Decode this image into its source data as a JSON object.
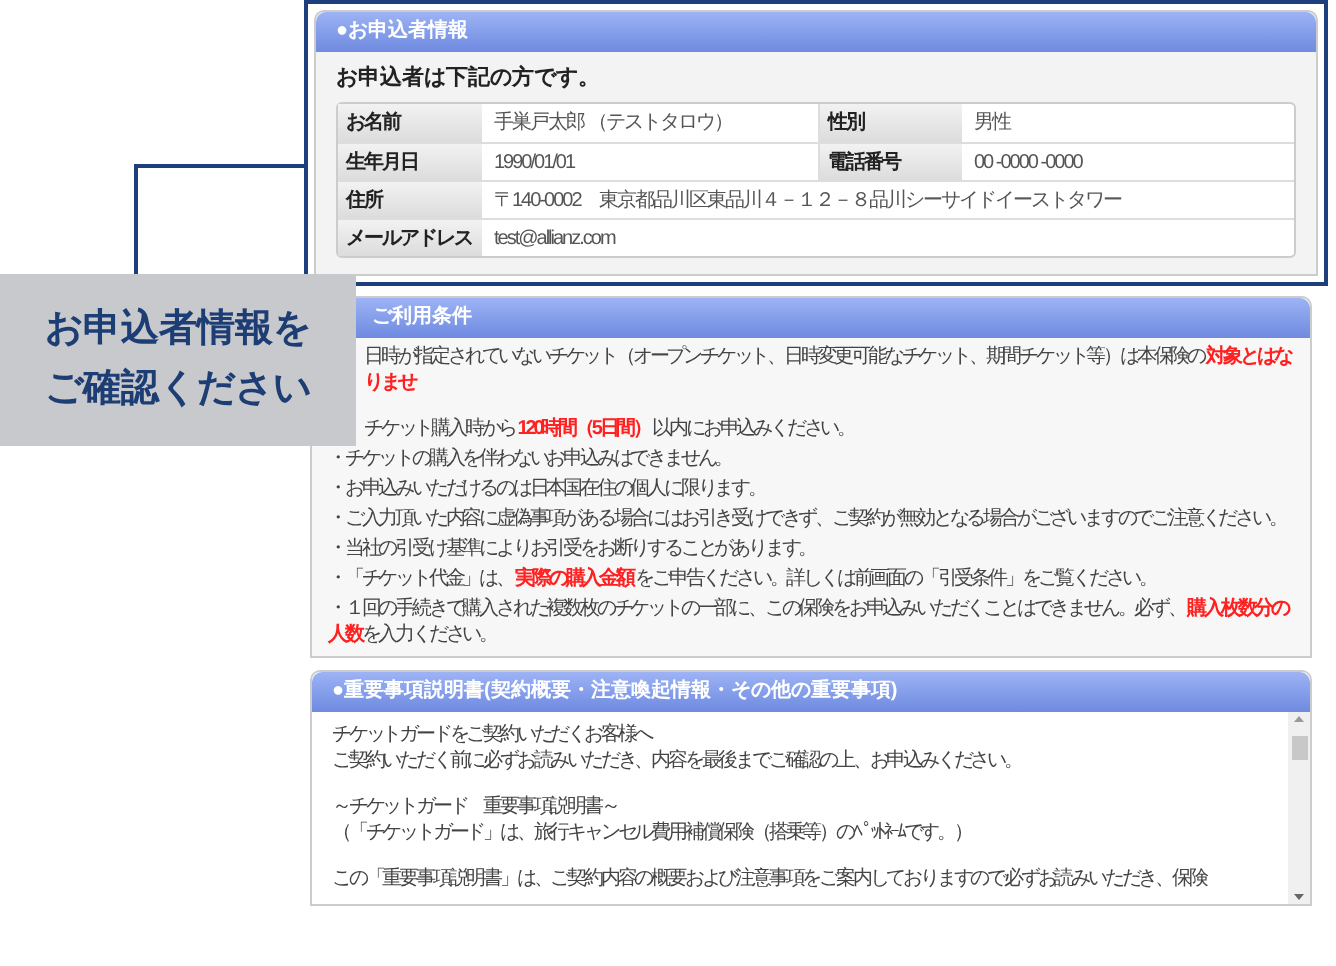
{
  "applicant": {
    "title": "●お申込者情報",
    "heading": "お申込者は下記の方です。",
    "rows": [
      [
        {
          "label": "お名前",
          "value": "手巣戸太郎 （テストタロウ）"
        },
        {
          "label": "性別",
          "value": "男性"
        }
      ],
      [
        {
          "label": "生年月日",
          "value": "1990/01/01"
        },
        {
          "label": "電話番号",
          "value": "00 -0000 -0000"
        }
      ],
      [
        {
          "label": "住所",
          "value": "〒140-0002　東京都品川区東品川４－１２－８品川シーサイドイーストタワー"
        }
      ],
      [
        {
          "label": "メールアドレス",
          "value": "test@allianz.com"
        }
      ]
    ]
  },
  "callout": {
    "lines": [
      "お申込者情報を",
      "ご確認ください"
    ]
  },
  "conditions": {
    "title": "ご利用条件",
    "items": [
      [
        {
          "text": "日時が指定されていないチケット（オープンチケット、日時変更可能なチケット、期間チケット等）は本保険の "
        },
        {
          "text": "対象とはなりませ",
          "emphasis": true
        }
      ],
      [
        {
          "text": "チケット購入時から "
        },
        {
          "text": "120時間（5日間）",
          "emphasis": true
        },
        {
          "text": " 以内にお申込みください。"
        }
      ],
      [
        {
          "text": "・チケットの購入を伴わないお申込みはできません。"
        }
      ],
      [
        {
          "text": "・お申込みいただけるのは日本国在住の個人に限ります。"
        }
      ],
      [
        {
          "text": "・ご入力頂いた内容に虚偽事項がある場合にはお引き受けできず、ご契約が無効となる場合がございますのでご注意ください。"
        }
      ],
      [
        {
          "text": "・当社の引受け基準によりお引受をお断りすることがあります。"
        }
      ],
      [
        {
          "text": "・「チケット代金」は、 "
        },
        {
          "text": "実際の購入金額",
          "emphasis": true
        },
        {
          "text": " をご申告ください。詳しくは前画面の「引受条件」をご覧ください。"
        }
      ],
      [
        {
          "text": "・１回の手続きで購入された複数枚のチケットの一部に、この保険をお申込みいただくことはできません。必ず、 "
        },
        {
          "text": "購入枚数分の人数",
          "emphasis": true
        },
        {
          "text": "を入力ください。"
        }
      ]
    ]
  },
  "important": {
    "title": "●重要事項説明書(契約概要・注意喚起情報・その他の重要事項)",
    "paragraphs": [
      [
        "チケットガードをご契約いただくお客様へ",
        "ご契約いただく前に必ずお読みいただき、内容を最後までご確認の上、お申込みください。"
      ],
      [
        "～チケットガード　重要事項説明書～",
        "（「チケットガード」は、旅行キャンセル費用補償保険（搭乗等）のﾍﾟｯﾄﾈｰﾑです。）"
      ],
      [
        "この「重要事項説明書」は、ご契約内容の概要および注意事項をご案内しておりますので必ずお読みいただき、保険"
      ]
    ]
  }
}
